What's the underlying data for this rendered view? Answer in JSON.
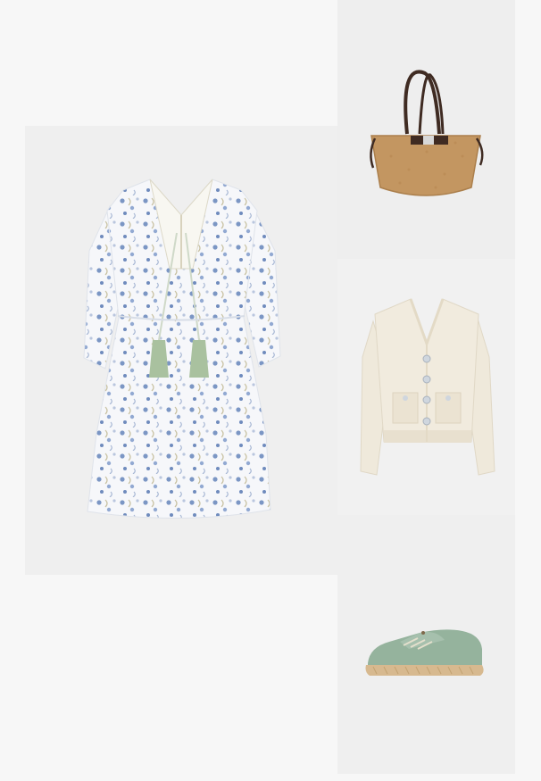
{
  "outfit": {
    "items": [
      {
        "id": "dress",
        "icon": "dress-product-image",
        "colors": {
          "background": "#efefef",
          "fabric": "#f4f6f9",
          "print": "#7b96c4",
          "accent": "#a9c19f"
        }
      },
      {
        "id": "bag",
        "icon": "tote-bag-product-image",
        "colors": {
          "background": "#eeeeee",
          "leather": "#c39661",
          "strap": "#3f2b22"
        }
      },
      {
        "id": "cardigan",
        "icon": "cardigan-product-image",
        "colors": {
          "background": "#f1f1f1",
          "knit": "#efe9db",
          "buttons": "#cfd6de"
        }
      },
      {
        "id": "sneaker",
        "icon": "espadrille-sneaker-product-image",
        "colors": {
          "background": "#efefef",
          "canvas": "#95b39d",
          "sole": "#d7b98f"
        }
      }
    ]
  }
}
